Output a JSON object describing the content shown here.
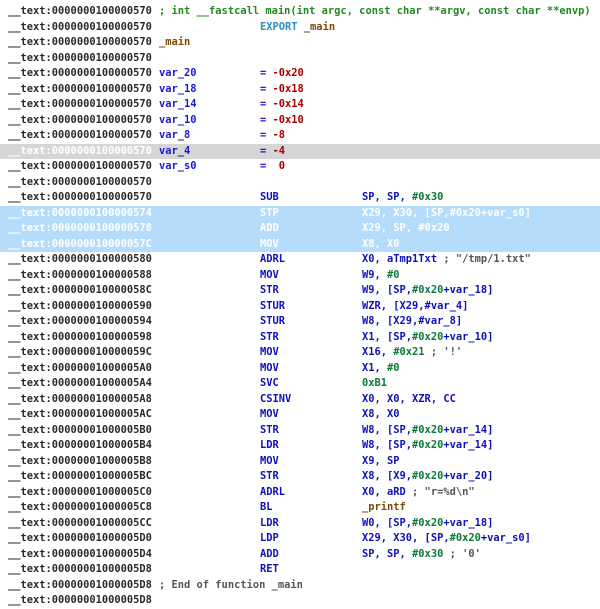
{
  "lines": [
    {
      "addr": "__text:0000000100000570",
      "label": [
        {
          "t": "; int __fastcall main(int argc, const char **argv, const char **envp)",
          "c": "comment"
        }
      ]
    },
    {
      "addr": "__text:0000000100000570",
      "value": [
        {
          "t": "EXPORT ",
          "c": "export"
        },
        {
          "t": "_main",
          "c": "func"
        }
      ]
    },
    {
      "addr": "__text:0000000100000570",
      "label": [
        {
          "t": "_main",
          "c": "func"
        }
      ]
    },
    {
      "addr": "__text:0000000100000570"
    },
    {
      "addr": "__text:0000000100000570",
      "label": [
        {
          "t": "var_20",
          "c": "var"
        }
      ],
      "value": [
        {
          "t": "= ",
          "c": "eq"
        },
        {
          "t": "-0x20",
          "c": "neg"
        }
      ]
    },
    {
      "addr": "__text:0000000100000570",
      "label": [
        {
          "t": "var_18",
          "c": "var"
        }
      ],
      "value": [
        {
          "t": "= ",
          "c": "eq"
        },
        {
          "t": "-0x18",
          "c": "neg"
        }
      ]
    },
    {
      "addr": "__text:0000000100000570",
      "label": [
        {
          "t": "var_14",
          "c": "var"
        }
      ],
      "value": [
        {
          "t": "= ",
          "c": "eq"
        },
        {
          "t": "-0x14",
          "c": "neg"
        }
      ]
    },
    {
      "addr": "__text:0000000100000570",
      "label": [
        {
          "t": "var_10",
          "c": "var"
        }
      ],
      "value": [
        {
          "t": "= ",
          "c": "eq"
        },
        {
          "t": "-0x10",
          "c": "neg"
        }
      ]
    },
    {
      "addr": "__text:0000000100000570",
      "label": [
        {
          "t": "var_8",
          "c": "var"
        }
      ],
      "value": [
        {
          "t": "= ",
          "c": "eq"
        },
        {
          "t": "-8",
          "c": "neg"
        }
      ]
    },
    {
      "addr": "__text:0000000100000570",
      "label": [
        {
          "t": "var_4",
          "c": "var"
        }
      ],
      "value": [
        {
          "t": "= ",
          "c": "eq"
        },
        {
          "t": "-4",
          "c": "neg"
        }
      ],
      "state": "hl"
    },
    {
      "addr": "__text:0000000100000570",
      "label": [
        {
          "t": "var_s0",
          "c": "var"
        }
      ],
      "value": [
        {
          "t": "=  ",
          "c": "eq"
        },
        {
          "t": "0",
          "c": "neg"
        }
      ]
    },
    {
      "addr": "__text:0000000100000570"
    },
    {
      "addr": "__text:0000000100000570",
      "mnem": "SUB",
      "ops": [
        {
          "t": "SP, SP, ",
          "c": "reg"
        },
        {
          "t": "#0x30",
          "c": "num"
        }
      ]
    },
    {
      "addr": "__text:0000000100000574",
      "mnem": "STP",
      "ops": [
        {
          "t": "X29, X30, [SP,#0x20+var_s0]",
          "c": "reg"
        }
      ],
      "state": "sel"
    },
    {
      "addr": "__text:0000000100000578",
      "mnem": "ADD",
      "ops": [
        {
          "t": "X29, SP, #0x20",
          "c": "reg"
        }
      ],
      "state": "sel"
    },
    {
      "addr": "__text:000000010000057C",
      "mnem": "MOV",
      "ops": [
        {
          "t": "X8, X0",
          "c": "reg"
        }
      ],
      "state": "sel"
    },
    {
      "addr": "__text:0000000100000580",
      "mnem": "ADRL",
      "ops": [
        {
          "t": "X0, aTmp1Txt ",
          "c": "reg"
        },
        {
          "t": "; \"/tmp/1.txt\"",
          "c": "str"
        }
      ]
    },
    {
      "addr": "__text:0000000100000588",
      "mnem": "MOV",
      "ops": [
        {
          "t": "W9, ",
          "c": "reg"
        },
        {
          "t": "#0",
          "c": "num"
        }
      ]
    },
    {
      "addr": "__text:000000010000058C",
      "mnem": "STR",
      "ops": [
        {
          "t": "W9, [SP,",
          "c": "reg"
        },
        {
          "t": "#0x20",
          "c": "num"
        },
        {
          "t": "+var_18]",
          "c": "reg"
        }
      ]
    },
    {
      "addr": "__text:0000000100000590",
      "mnem": "STUR",
      "ops": [
        {
          "t": "WZR, [X29,#var_4]",
          "c": "reg"
        }
      ]
    },
    {
      "addr": "__text:0000000100000594",
      "mnem": "STUR",
      "ops": [
        {
          "t": "W8, [X29,#var_8]",
          "c": "reg"
        }
      ]
    },
    {
      "addr": "__text:0000000100000598",
      "mnem": "STR",
      "ops": [
        {
          "t": "X1, [SP,",
          "c": "reg"
        },
        {
          "t": "#0x20",
          "c": "num"
        },
        {
          "t": "+var_10]",
          "c": "reg"
        }
      ]
    },
    {
      "addr": "__text:000000010000059C",
      "mnem": "MOV",
      "ops": [
        {
          "t": "X16, ",
          "c": "reg"
        },
        {
          "t": "#0x21",
          "c": "num"
        },
        {
          "t": " ; '!'",
          "c": "str"
        }
      ]
    },
    {
      "addr": "__text:00000001000005A0",
      "mnem": "MOV",
      "ops": [
        {
          "t": "X1, ",
          "c": "reg"
        },
        {
          "t": "#0",
          "c": "num"
        }
      ]
    },
    {
      "addr": "__text:00000001000005A4",
      "mnem": "SVC",
      "ops": [
        {
          "t": "0xB1",
          "c": "num"
        }
      ]
    },
    {
      "addr": "__text:00000001000005A8",
      "mnem": "CSINV",
      "ops": [
        {
          "t": "X0, X0, XZR, CC",
          "c": "reg"
        }
      ]
    },
    {
      "addr": "__text:00000001000005AC",
      "mnem": "MOV",
      "ops": [
        {
          "t": "X8, X0",
          "c": "reg"
        }
      ]
    },
    {
      "addr": "__text:00000001000005B0",
      "mnem": "STR",
      "ops": [
        {
          "t": "W8, [SP,",
          "c": "reg"
        },
        {
          "t": "#0x20",
          "c": "num"
        },
        {
          "t": "+var_14]",
          "c": "reg"
        }
      ]
    },
    {
      "addr": "__text:00000001000005B4",
      "mnem": "LDR",
      "ops": [
        {
          "t": "W8, [SP,",
          "c": "reg"
        },
        {
          "t": "#0x20",
          "c": "num"
        },
        {
          "t": "+var_14]",
          "c": "reg"
        }
      ]
    },
    {
      "addr": "__text:00000001000005B8",
      "mnem": "MOV",
      "ops": [
        {
          "t": "X9, SP",
          "c": "reg"
        }
      ]
    },
    {
      "addr": "__text:00000001000005BC",
      "mnem": "STR",
      "ops": [
        {
          "t": "X8, [X9,",
          "c": "reg"
        },
        {
          "t": "#0x20",
          "c": "num"
        },
        {
          "t": "+var_20]",
          "c": "reg"
        }
      ]
    },
    {
      "addr": "__text:00000001000005C0",
      "mnem": "ADRL",
      "ops": [
        {
          "t": "X0, aRD ",
          "c": "reg"
        },
        {
          "t": "; \"r=%d\\n\"",
          "c": "str"
        }
      ]
    },
    {
      "addr": "__text:00000001000005C8",
      "mnem": "BL",
      "ops": [
        {
          "t": "_printf",
          "c": "func"
        }
      ]
    },
    {
      "addr": "__text:00000001000005CC",
      "mnem": "LDR",
      "ops": [
        {
          "t": "W0, [SP,",
          "c": "reg"
        },
        {
          "t": "#0x20",
          "c": "num"
        },
        {
          "t": "+var_18]",
          "c": "reg"
        }
      ]
    },
    {
      "addr": "__text:00000001000005D0",
      "mnem": "LDP",
      "ops": [
        {
          "t": "X29, X30, [SP,",
          "c": "reg"
        },
        {
          "t": "#0x20",
          "c": "num"
        },
        {
          "t": "+var_s0]",
          "c": "reg"
        }
      ]
    },
    {
      "addr": "__text:00000001000005D4",
      "mnem": "ADD",
      "ops": [
        {
          "t": "SP, SP, ",
          "c": "reg"
        },
        {
          "t": "#0x30",
          "c": "num"
        },
        {
          "t": " ; '0'",
          "c": "str"
        }
      ]
    },
    {
      "addr": "__text:00000001000005D8",
      "mnem": "RET"
    },
    {
      "addr": "__text:00000001000005D8",
      "label": [
        {
          "t": "; End of function _main",
          "c": "str"
        }
      ]
    },
    {
      "addr": "__text:00000001000005D8"
    }
  ]
}
